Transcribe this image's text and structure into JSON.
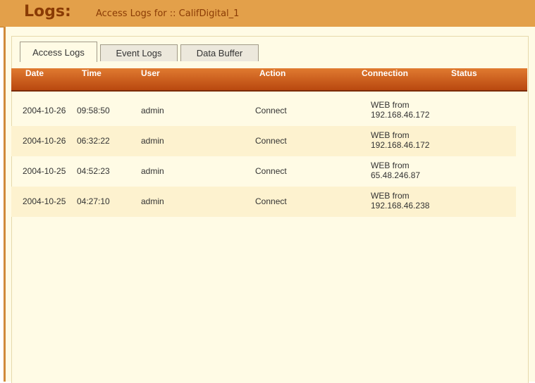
{
  "header": {
    "title": "Logs:",
    "subtitle": "Access Logs for :: CalifDigital_1"
  },
  "tabs": [
    {
      "label": "Access Logs",
      "active": true
    },
    {
      "label": "Event Logs",
      "active": false
    },
    {
      "label": "Data Buffer",
      "active": false
    }
  ],
  "table": {
    "columns": [
      "Date",
      "Time",
      "User",
      "Action",
      "Connection",
      "Status"
    ],
    "rows": [
      {
        "date": "2004-10-26",
        "time": "09:58:50",
        "user": "admin",
        "action": "Connect",
        "connection_line1": "WEB from",
        "connection_line2": "192.168.46.172",
        "status": ""
      },
      {
        "date": "2004-10-26",
        "time": "06:32:22",
        "user": "admin",
        "action": "Connect",
        "connection_line1": "WEB from",
        "connection_line2": "192.168.46.172",
        "status": ""
      },
      {
        "date": "2004-10-25",
        "time": "04:52:23",
        "user": "admin",
        "action": "Connect",
        "connection_line1": "WEB from",
        "connection_line2": "65.48.246.87",
        "status": ""
      },
      {
        "date": "2004-10-25",
        "time": "04:27:10",
        "user": "admin",
        "action": "Connect",
        "connection_line1": "WEB from",
        "connection_line2": "192.168.46.238",
        "status": ""
      }
    ]
  },
  "colors": {
    "header_bg": "#e3a04a",
    "title_text": "#8a3b05",
    "table_header": "#c85a18",
    "content_bg": "#fffbe5",
    "alt_row": "#fdf2cf"
  }
}
